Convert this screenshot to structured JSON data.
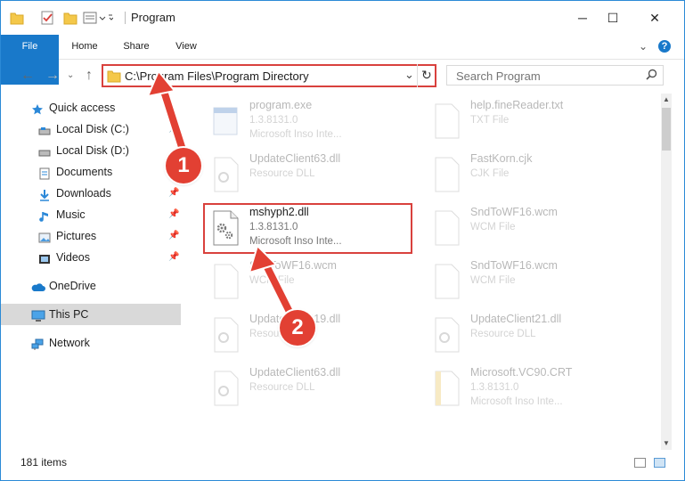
{
  "window": {
    "title": "Program",
    "controls": {
      "minimize": "─",
      "maximize": "☐",
      "close": "✕"
    }
  },
  "ribbon": {
    "tabs": [
      {
        "label": "File"
      },
      {
        "label": "Home"
      },
      {
        "label": "Share"
      },
      {
        "label": "View"
      }
    ],
    "help": "?"
  },
  "nav": {
    "back": "←",
    "forward": "→",
    "up": "↑",
    "address": "C:\\Program Files\\Program Directory",
    "dropdown": "⌄",
    "refresh": "↻",
    "search_placeholder": "Search Program"
  },
  "sidebar": {
    "items": [
      {
        "label": "Quick access",
        "icon": "star-icon"
      },
      {
        "label": "Local Disk (C:)",
        "icon": "drive-icon"
      },
      {
        "label": "Local Disk (D:)",
        "icon": "drive-icon"
      },
      {
        "label": "Documents",
        "icon": "documents-icon"
      },
      {
        "label": "Downloads",
        "icon": "download-icon"
      },
      {
        "label": "Music",
        "icon": "music-icon"
      },
      {
        "label": "Pictures",
        "icon": "pictures-icon"
      },
      {
        "label": "Videos",
        "icon": "videos-icon"
      },
      {
        "label": "OneDrive",
        "icon": "cloud-icon"
      },
      {
        "label": "This PC",
        "icon": "computer-icon"
      },
      {
        "label": "Network",
        "icon": "network-icon"
      }
    ]
  },
  "files": [
    {
      "name": "program.exe",
      "type": "1.3.8131.0",
      "desc": "Microsoft Inso Inte..."
    },
    {
      "name": "help.fineReader.txt",
      "type": "TXT File",
      "desc": ""
    },
    {
      "name": "UpdateClient63.dll",
      "type": "Resource DLL",
      "desc": ""
    },
    {
      "name": "FastKorn.cjk",
      "type": "CJK File",
      "desc": ""
    },
    {
      "name": "mshyph2.dll",
      "type": "1.3.8131.0",
      "desc": "Microsoft Inso Inte..."
    },
    {
      "name": "SndToWF16.wcm",
      "type": "WCM File",
      "desc": ""
    },
    {
      "name": "SndToWF16.wcm",
      "type": "WCM File",
      "desc": ""
    },
    {
      "name": "SndToWF16.wcm",
      "type": "WCM File",
      "desc": ""
    },
    {
      "name": "UpdateClient19.dll",
      "type": "Resource DLL",
      "desc": ""
    },
    {
      "name": "UpdateClient21.dll",
      "type": "Resource DLL",
      "desc": ""
    },
    {
      "name": "UpdateClient63.dll",
      "type": "Resource DLL",
      "desc": ""
    },
    {
      "name": "Microsoft.VC90.CRT",
      "type": "1.3.8131.0",
      "desc": "Microsoft Inso Inte..."
    }
  ],
  "status": {
    "item_count": "181 items"
  },
  "annotations": [
    {
      "label": "1"
    },
    {
      "label": "2"
    }
  ],
  "colors": {
    "accent": "#1979ca",
    "highlight": "#d9413d",
    "badge": "#e24033",
    "selected": "#d9d9d9"
  }
}
